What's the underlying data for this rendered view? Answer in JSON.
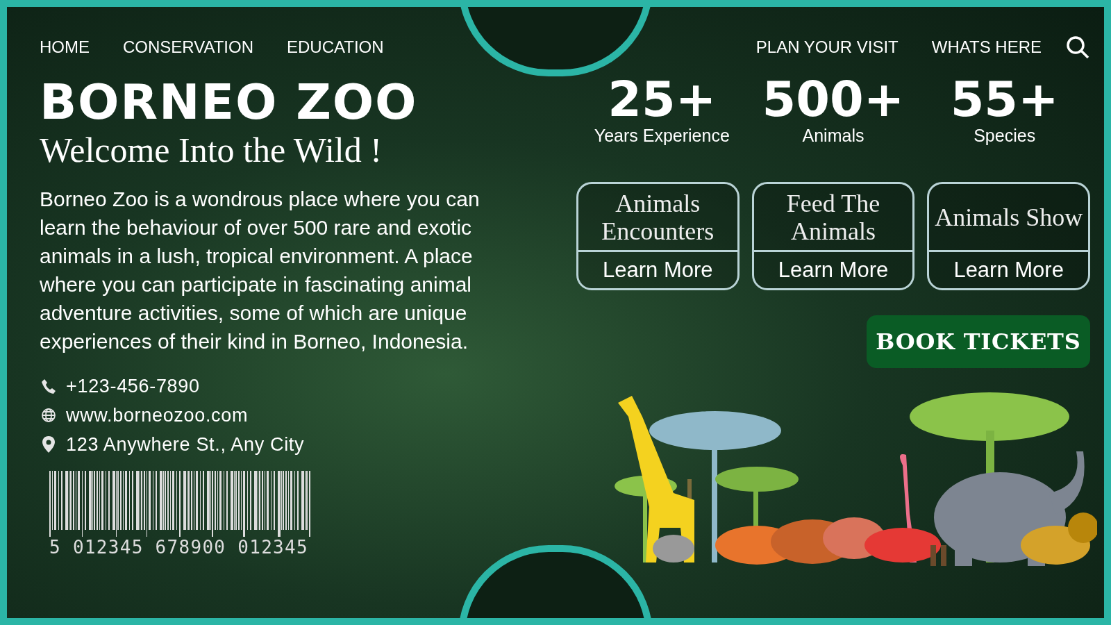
{
  "nav_left": [
    {
      "label": "HOME"
    },
    {
      "label": "CONSERVATION"
    },
    {
      "label": "EDUCATION"
    }
  ],
  "nav_right": [
    {
      "label": "PLAN YOUR VISIT"
    },
    {
      "label": "WHATS HERE"
    }
  ],
  "title": "BORNEO ZOO",
  "subtitle": "Welcome Into the Wild !",
  "description": "Borneo Zoo is a wondrous place where you can learn the behaviour of over 500 rare and exotic animals in a lush, tropical environment. A place where you can participate in fascinating animal adventure activities, some of which are unique experiences of their kind in Borneo, Indonesia.",
  "contacts": [
    {
      "kind": "phone",
      "text": "+123-456-7890"
    },
    {
      "kind": "web",
      "text": "www.borneozoo.com"
    },
    {
      "kind": "location",
      "text": "123 Anywhere St., Any City"
    }
  ],
  "barcode": {
    "digits": "5 012345 678900 012345"
  },
  "stats": [
    {
      "value": "25+",
      "label": "Years Experience"
    },
    {
      "value": "500+",
      "label": "Animals"
    },
    {
      "value": "55+",
      "label": "Species"
    }
  ],
  "cards": [
    {
      "title": "Animals Encounters",
      "button": "Learn More"
    },
    {
      "title": "Feed The Animals",
      "button": "Learn More"
    },
    {
      "title": "Animals Show",
      "button": "Learn More"
    }
  ],
  "book_button": "BOOK TICKETS"
}
